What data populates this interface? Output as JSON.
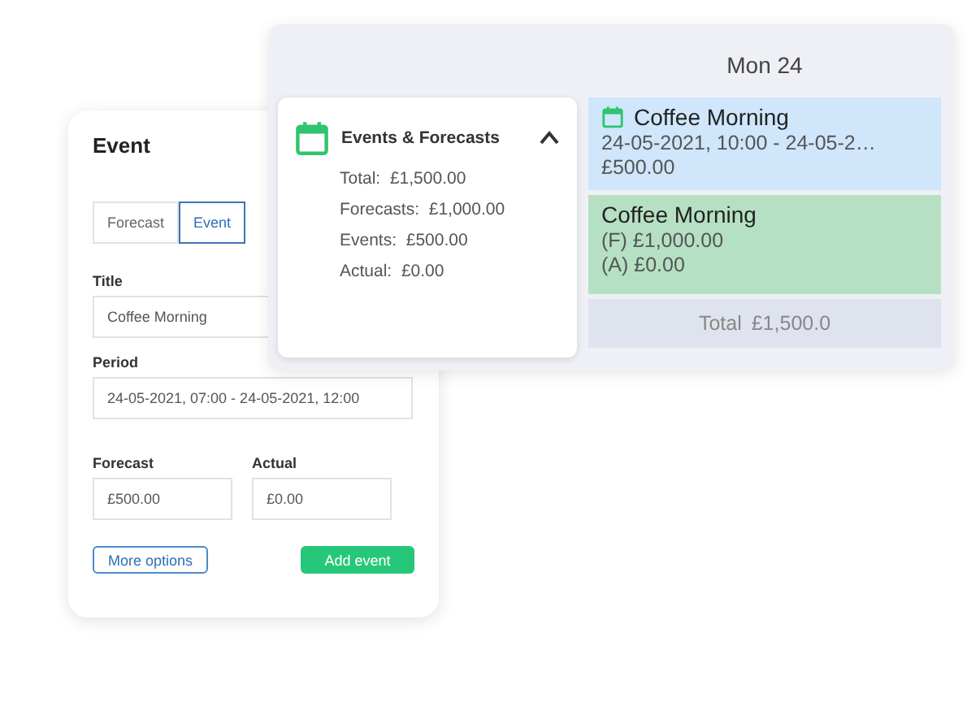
{
  "event_form": {
    "title": "Event",
    "mode_tabs": [
      {
        "label": "Forecast",
        "selected": false
      },
      {
        "label": "Event",
        "selected": true
      }
    ],
    "fields": [
      {
        "label": "Title",
        "value": "Coffee Morning"
      },
      {
        "label": "Period",
        "value": "24-05-2021, 07:00 - 24-05-2021, 12:00"
      }
    ],
    "amount_fields": [
      {
        "label": "Forecast",
        "currency": "£",
        "value": "500.00"
      },
      {
        "label": "Actual",
        "currency": "£",
        "value": "0.00"
      }
    ],
    "buttons": [
      {
        "label": "More options",
        "kind": "outline"
      },
      {
        "label": "Add event",
        "kind": "primary"
      }
    ]
  },
  "calendar": {
    "day_header": "Mon 24",
    "summary": {
      "title": "Events & Forecasts",
      "expanded": true,
      "lines": [
        {
          "label": "Total:",
          "value": "£1,500.00"
        },
        {
          "label": "Forecasts:",
          "value": "£1,000.00"
        },
        {
          "label": "Events:",
          "value": "£500.00"
        },
        {
          "label": "Actual:",
          "value": "£0.00"
        }
      ]
    },
    "entries": [
      {
        "kind": "event",
        "title": "Coffee Morning",
        "lines": [
          "24-05-2021, 10:00 - 24-05-2…",
          "£500.00"
        ]
      },
      {
        "kind": "forecast",
        "title": "Coffee Morning",
        "lines": [
          "(F) £1,000.00",
          "(A) £0.00"
        ]
      }
    ],
    "total": {
      "label": "Total",
      "value": "£1,500.0"
    }
  }
}
